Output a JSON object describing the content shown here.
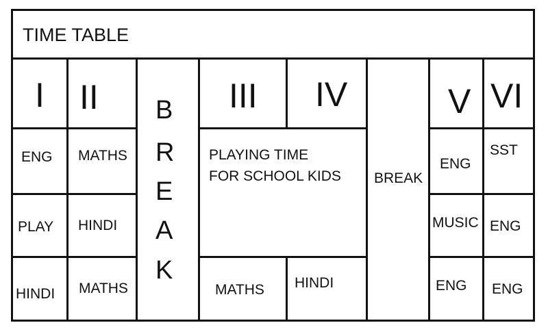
{
  "title": "TIME TABLE",
  "periods": [
    "I",
    "II",
    "III",
    "IV",
    "V",
    "VI"
  ],
  "columns": {
    "col1": [
      "ENG",
      "PLAY",
      "HINDI"
    ],
    "col2": [
      "MATHS",
      "HINDI",
      "MATHS"
    ],
    "first_break_letters": [
      "B",
      "R",
      "E",
      "A",
      "K"
    ],
    "playing_time": {
      "line1": "PLAYING TIME",
      "line2": "FOR SCHOOL KIDS"
    },
    "col3_bottom": "MATHS",
    "col4_bottom": "HINDI",
    "second_break": "BREAK",
    "col5": [
      "ENG",
      "MUSIC",
      "ENG"
    ],
    "col6": [
      "SST",
      "ENG",
      "ENG"
    ]
  }
}
